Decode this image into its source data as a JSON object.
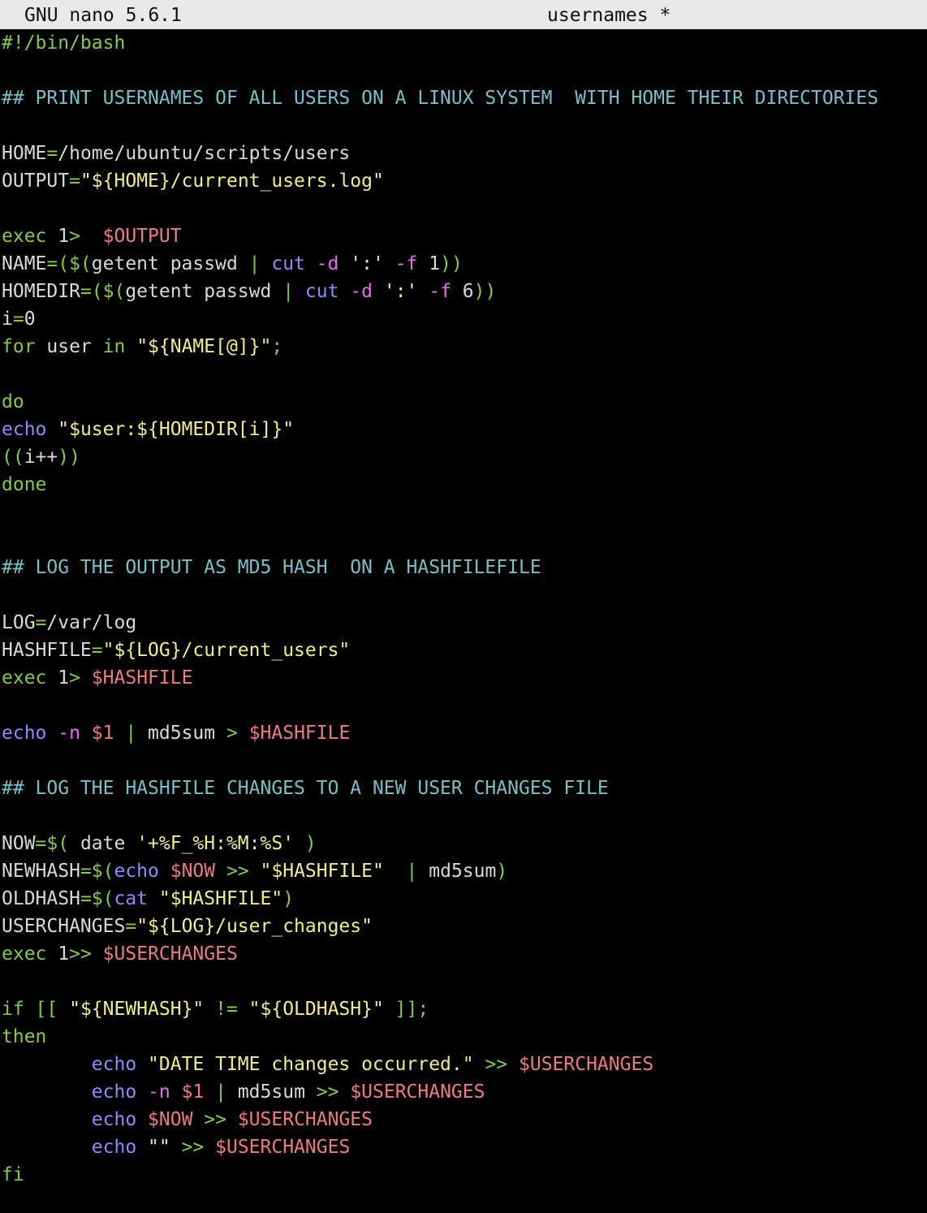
{
  "window": {
    "app_version": "GNU nano 5.6.1",
    "filename": "usernames *"
  },
  "colors": {
    "default": "#d8d8d8",
    "comment": "#6fc2c8",
    "keyword": "#7fcf3a",
    "string": "#f2ee7e",
    "variable": "#f07a78",
    "command": "#8b8bff",
    "option": "#e86af0",
    "titlebar_bg": "#e9e9e9"
  },
  "lines": [
    [
      {
        "text": "#!/bin/bash",
        "c": "keyword"
      }
    ],
    [],
    [
      {
        "text": "## PRINT USERNAMES OF ALL USERS ON A LINUX SYSTEM  WITH HOME THEIR DIRECTORIES",
        "c": "comment"
      }
    ],
    [],
    [
      {
        "text": "HOME",
        "c": "default"
      },
      {
        "text": "=",
        "c": "keyword"
      },
      {
        "text": "/home/ubuntu/scripts/users",
        "c": "default"
      }
    ],
    [
      {
        "text": "OUTPUT",
        "c": "default"
      },
      {
        "text": "=",
        "c": "keyword"
      },
      {
        "text": "\"${HOME}/current_users.log\"",
        "c": "string"
      }
    ],
    [],
    [
      {
        "text": "exec ",
        "c": "keyword"
      },
      {
        "text": "1",
        "c": "default"
      },
      {
        "text": ">  ",
        "c": "keyword"
      },
      {
        "text": "$OUTPUT",
        "c": "variable"
      }
    ],
    [
      {
        "text": "NAME",
        "c": "default"
      },
      {
        "text": "=($(",
        "c": "keyword"
      },
      {
        "text": "getent passwd ",
        "c": "default"
      },
      {
        "text": "| ",
        "c": "keyword"
      },
      {
        "text": "cut ",
        "c": "command"
      },
      {
        "text": "-d ",
        "c": "option"
      },
      {
        "text": "':' ",
        "c": "string"
      },
      {
        "text": "-f ",
        "c": "option"
      },
      {
        "text": "1",
        "c": "default"
      },
      {
        "text": "))",
        "c": "keyword"
      }
    ],
    [
      {
        "text": "HOMEDIR",
        "c": "default"
      },
      {
        "text": "=($(",
        "c": "keyword"
      },
      {
        "text": "getent passwd ",
        "c": "default"
      },
      {
        "text": "| ",
        "c": "keyword"
      },
      {
        "text": "cut ",
        "c": "command"
      },
      {
        "text": "-d ",
        "c": "option"
      },
      {
        "text": "':' ",
        "c": "string"
      },
      {
        "text": "-f ",
        "c": "option"
      },
      {
        "text": "6",
        "c": "default"
      },
      {
        "text": "))",
        "c": "keyword"
      }
    ],
    [
      {
        "text": "i",
        "c": "default"
      },
      {
        "text": "=",
        "c": "keyword"
      },
      {
        "text": "0",
        "c": "default"
      }
    ],
    [
      {
        "text": "for ",
        "c": "keyword"
      },
      {
        "text": "user ",
        "c": "default"
      },
      {
        "text": "in ",
        "c": "keyword"
      },
      {
        "text": "\"${NAME[@]}\"",
        "c": "string"
      },
      {
        "text": ";",
        "c": "keyword"
      }
    ],
    [],
    [
      {
        "text": "do",
        "c": "keyword"
      }
    ],
    [
      {
        "text": "echo ",
        "c": "command"
      },
      {
        "text": "\"$user:${HOMEDIR[i]}\"",
        "c": "string"
      }
    ],
    [
      {
        "text": "((",
        "c": "keyword"
      },
      {
        "text": "i++",
        "c": "default"
      },
      {
        "text": "))",
        "c": "keyword"
      }
    ],
    [
      {
        "text": "done",
        "c": "keyword"
      }
    ],
    [],
    [],
    [
      {
        "text": "## LOG THE OUTPUT AS MD5 HASH  ON A HASHFILEFILE",
        "c": "comment"
      }
    ],
    [],
    [
      {
        "text": "LOG",
        "c": "default"
      },
      {
        "text": "=",
        "c": "keyword"
      },
      {
        "text": "/var/log",
        "c": "default"
      }
    ],
    [
      {
        "text": "HASHFILE",
        "c": "default"
      },
      {
        "text": "=",
        "c": "keyword"
      },
      {
        "text": "\"${LOG}/current_users\"",
        "c": "string"
      }
    ],
    [
      {
        "text": "exec ",
        "c": "keyword"
      },
      {
        "text": "1",
        "c": "default"
      },
      {
        "text": "> ",
        "c": "keyword"
      },
      {
        "text": "$HASHFILE",
        "c": "variable"
      }
    ],
    [],
    [
      {
        "text": "echo ",
        "c": "command"
      },
      {
        "text": "-n ",
        "c": "option"
      },
      {
        "text": "$1 ",
        "c": "variable"
      },
      {
        "text": "| ",
        "c": "keyword"
      },
      {
        "text": "md5sum ",
        "c": "default"
      },
      {
        "text": "> ",
        "c": "keyword"
      },
      {
        "text": "$HASHFILE",
        "c": "variable"
      }
    ],
    [],
    [
      {
        "text": "## LOG THE HASHFILE CHANGES TO A NEW USER CHANGES FILE",
        "c": "comment"
      }
    ],
    [],
    [
      {
        "text": "NOW",
        "c": "default"
      },
      {
        "text": "=$( ",
        "c": "keyword"
      },
      {
        "text": "date ",
        "c": "default"
      },
      {
        "text": "'+%F_%H:%M:%S' ",
        "c": "string"
      },
      {
        "text": ")",
        "c": "keyword"
      }
    ],
    [
      {
        "text": "NEWHASH",
        "c": "default"
      },
      {
        "text": "=$(",
        "c": "keyword"
      },
      {
        "text": "echo ",
        "c": "command"
      },
      {
        "text": "$NOW ",
        "c": "variable"
      },
      {
        "text": ">> ",
        "c": "keyword"
      },
      {
        "text": "\"$HASHFILE\"  ",
        "c": "string"
      },
      {
        "text": "| ",
        "c": "keyword"
      },
      {
        "text": "md5sum",
        "c": "default"
      },
      {
        "text": ")",
        "c": "keyword"
      }
    ],
    [
      {
        "text": "OLDHASH",
        "c": "default"
      },
      {
        "text": "=$(",
        "c": "keyword"
      },
      {
        "text": "cat ",
        "c": "command"
      },
      {
        "text": "\"$HASHFILE\"",
        "c": "string"
      },
      {
        "text": ")",
        "c": "keyword"
      }
    ],
    [
      {
        "text": "USERCHANGES",
        "c": "default"
      },
      {
        "text": "=",
        "c": "keyword"
      },
      {
        "text": "\"${LOG}/user_changes\"",
        "c": "string"
      }
    ],
    [
      {
        "text": "exec ",
        "c": "keyword"
      },
      {
        "text": "1",
        "c": "default"
      },
      {
        "text": ">> ",
        "c": "keyword"
      },
      {
        "text": "$USERCHANGES",
        "c": "variable"
      }
    ],
    [],
    [
      {
        "text": "if [[ ",
        "c": "keyword"
      },
      {
        "text": "\"${NEWHASH}\" ",
        "c": "string"
      },
      {
        "text": "!= ",
        "c": "keyword"
      },
      {
        "text": "\"${OLDHASH}\" ",
        "c": "string"
      },
      {
        "text": "]];",
        "c": "keyword"
      }
    ],
    [
      {
        "text": "then",
        "c": "keyword"
      }
    ],
    [
      {
        "text": "        ",
        "c": "default"
      },
      {
        "text": "echo ",
        "c": "command"
      },
      {
        "text": "\"DATE TIME changes occurred.\" ",
        "c": "string"
      },
      {
        "text": ">> ",
        "c": "keyword"
      },
      {
        "text": "$USERCHANGES",
        "c": "variable"
      }
    ],
    [
      {
        "text": "        ",
        "c": "default"
      },
      {
        "text": "echo ",
        "c": "command"
      },
      {
        "text": "-n ",
        "c": "option"
      },
      {
        "text": "$1 ",
        "c": "variable"
      },
      {
        "text": "| ",
        "c": "keyword"
      },
      {
        "text": "md5sum ",
        "c": "default"
      },
      {
        "text": ">> ",
        "c": "keyword"
      },
      {
        "text": "$USERCHANGES",
        "c": "variable"
      }
    ],
    [
      {
        "text": "        ",
        "c": "default"
      },
      {
        "text": "echo ",
        "c": "command"
      },
      {
        "text": "$NOW ",
        "c": "variable"
      },
      {
        "text": ">> ",
        "c": "keyword"
      },
      {
        "text": "$USERCHANGES",
        "c": "variable"
      }
    ],
    [
      {
        "text": "        ",
        "c": "default"
      },
      {
        "text": "echo ",
        "c": "command"
      },
      {
        "text": "\"\" ",
        "c": "string"
      },
      {
        "text": ">> ",
        "c": "keyword"
      },
      {
        "text": "$USERCHANGES",
        "c": "variable"
      }
    ],
    [
      {
        "text": "fi",
        "c": "keyword"
      }
    ]
  ]
}
